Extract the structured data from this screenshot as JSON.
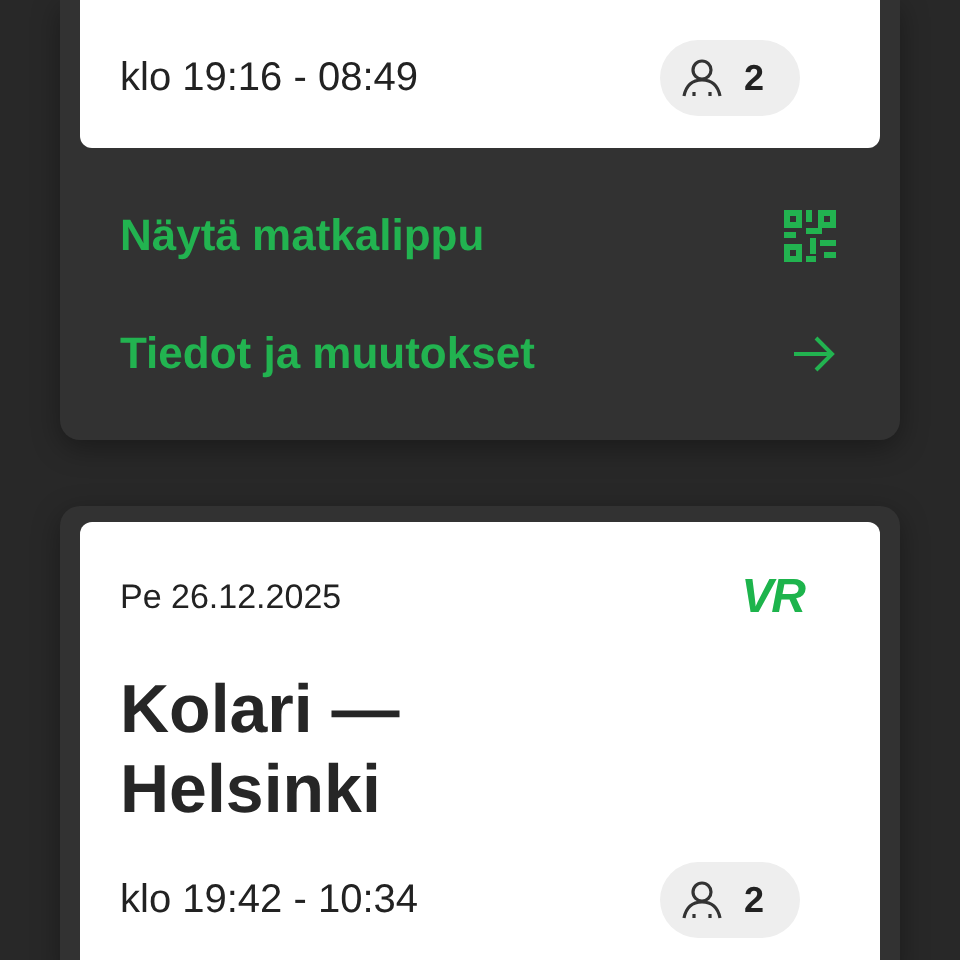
{
  "trips": [
    {
      "time": "klo 19:16 - 08:49",
      "passengers": "2",
      "actions": [
        {
          "kind": "qr",
          "label": "Näytä matkalippu"
        },
        {
          "kind": "arrow",
          "label": "Tiedot ja muutokset"
        }
      ]
    },
    {
      "date": "Pe 26.12.2025",
      "logo": "VR",
      "title": [
        "Kolari —",
        "Helsinki"
      ],
      "time": "klo 19:42 - 10:34",
      "passengers": "2"
    }
  ]
}
